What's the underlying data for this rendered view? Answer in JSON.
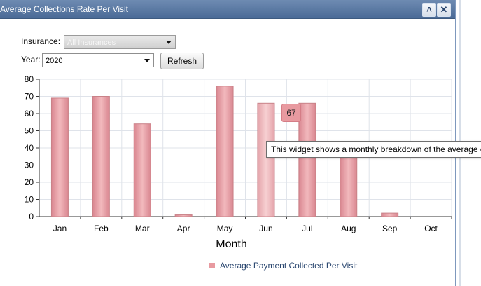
{
  "window": {
    "title": "Average Collections Rate Per Visit",
    "collapse_icon": "chevron-up-icon",
    "close_icon": "close-icon"
  },
  "filters": {
    "insurance_label": "Insurance:",
    "insurance_value": "All Insurances",
    "year_label": "Year:",
    "year_value": "2020",
    "refresh_label": "Refresh"
  },
  "tooltip": {
    "value": "67",
    "text": "This widget shows a monthly breakdown of the average c"
  },
  "colors": {
    "bar": "#e89aa0",
    "bar_border": "#c98288",
    "grid": "#dfe3ea",
    "title_bar": "#5677a4"
  },
  "chart_data": {
    "type": "bar",
    "categories": [
      "Jan",
      "Feb",
      "Mar",
      "Apr",
      "May",
      "Jun",
      "Jul",
      "Aug",
      "Sep",
      "Oct"
    ],
    "series": [
      {
        "name": "Average Payment Collected Per Visit",
        "values": [
          69,
          70,
          54,
          1,
          76,
          66,
          66,
          36,
          2,
          0
        ]
      }
    ],
    "title": "",
    "xlabel": "Month",
    "ylabel": "",
    "ylim": [
      0,
      80
    ],
    "yticks": [
      "0",
      "10",
      "20",
      "30",
      "40",
      "50",
      "60",
      "70",
      "80"
    ],
    "grid": true,
    "legend_position": "bottom"
  }
}
